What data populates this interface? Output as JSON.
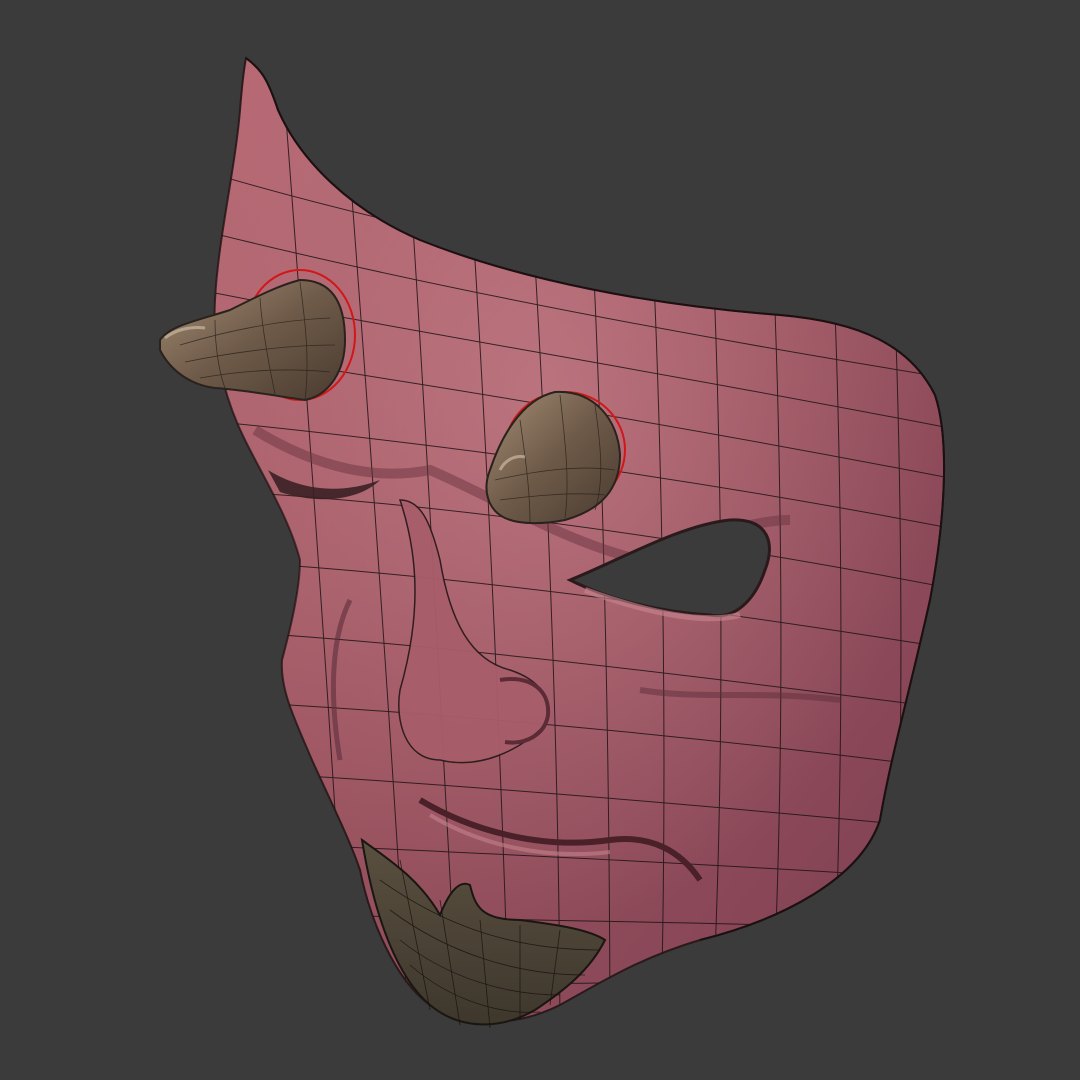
{
  "scene": {
    "subject": "mask-3d-model",
    "colors": {
      "background": "#3b3b3b",
      "mask_base": "#8f4a55",
      "mask_highlight": "#c47f88",
      "mask_shadow": "#5e2d3a",
      "horn_base": "#6f5c4a",
      "horn_highlight": "#a08a74",
      "chin_guard": "#4e4638",
      "wire": "#1e1416",
      "seam": "#d01818"
    }
  }
}
